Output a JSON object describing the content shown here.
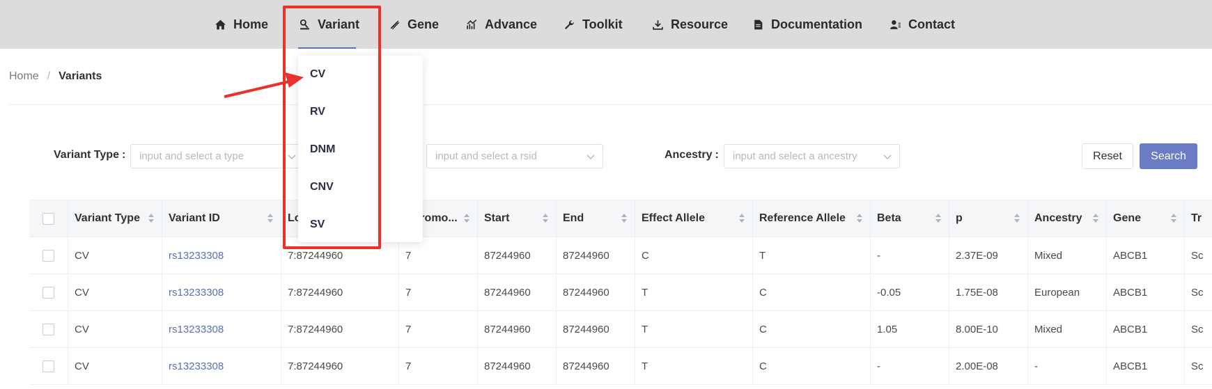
{
  "nav": {
    "items": [
      {
        "label": "Home",
        "icon": "home-icon"
      },
      {
        "label": "Variant",
        "icon": "variant-icon"
      },
      {
        "label": "Gene",
        "icon": "dna-icon"
      },
      {
        "label": "Advance",
        "icon": "chart-icon"
      },
      {
        "label": "Toolkit",
        "icon": "wrench-icon"
      },
      {
        "label": "Resource",
        "icon": "download-icon"
      },
      {
        "label": "Documentation",
        "icon": "document-icon"
      },
      {
        "label": "Contact",
        "icon": "contact-icon"
      }
    ],
    "active": "Variant"
  },
  "breadcrumb": {
    "home": "Home",
    "separator": "/",
    "current": "Variants"
  },
  "filters": {
    "variant_type": {
      "label": "Variant Type",
      "colon": ":",
      "placeholder": "input and select a type"
    },
    "rsid": {
      "placeholder": "input and select a rsid"
    },
    "ancestry": {
      "label": "Ancestry",
      "colon": ":",
      "placeholder": "input and select a ancestry"
    },
    "reset_label": "Reset",
    "search_label": "Search"
  },
  "dropdown": {
    "items": [
      "CV",
      "RV",
      "DNM",
      "CNV",
      "SV"
    ]
  },
  "table": {
    "columns": [
      "Variant Type",
      "Variant ID",
      "Lo",
      "Chromo...",
      "Start",
      "End",
      "Effect Allele",
      "Reference Allele",
      "Beta",
      "p",
      "Ancestry",
      "Gene",
      "Tr"
    ],
    "rows": [
      [
        "CV",
        "rs13233308",
        "7:87244960",
        "7",
        "87244960",
        "87244960",
        "C",
        "T",
        "-",
        "2.37E-09",
        "Mixed",
        "ABCB1",
        "Sc"
      ],
      [
        "CV",
        "rs13233308",
        "7:87244960",
        "7",
        "87244960",
        "87244960",
        "T",
        "C",
        "-0.05",
        "1.75E-08",
        "European",
        "ABCB1",
        "Sc"
      ],
      [
        "CV",
        "rs13233308",
        "7:87244960",
        "7",
        "87244960",
        "87244960",
        "T",
        "C",
        "1.05",
        "8.00E-10",
        "Mixed",
        "ABCB1",
        "Sc"
      ],
      [
        "CV",
        "rs13233308",
        "7:87244960",
        "7",
        "87244960",
        "87244960",
        "T",
        "C",
        "-",
        "2.00E-08",
        "-",
        "ABCB1",
        "Sc"
      ]
    ]
  },
  "colors": {
    "nav_bg": "#dcdcdc",
    "accent": "#6a7cc4",
    "link": "#5a6fb5",
    "annotation": "#e8322b"
  }
}
